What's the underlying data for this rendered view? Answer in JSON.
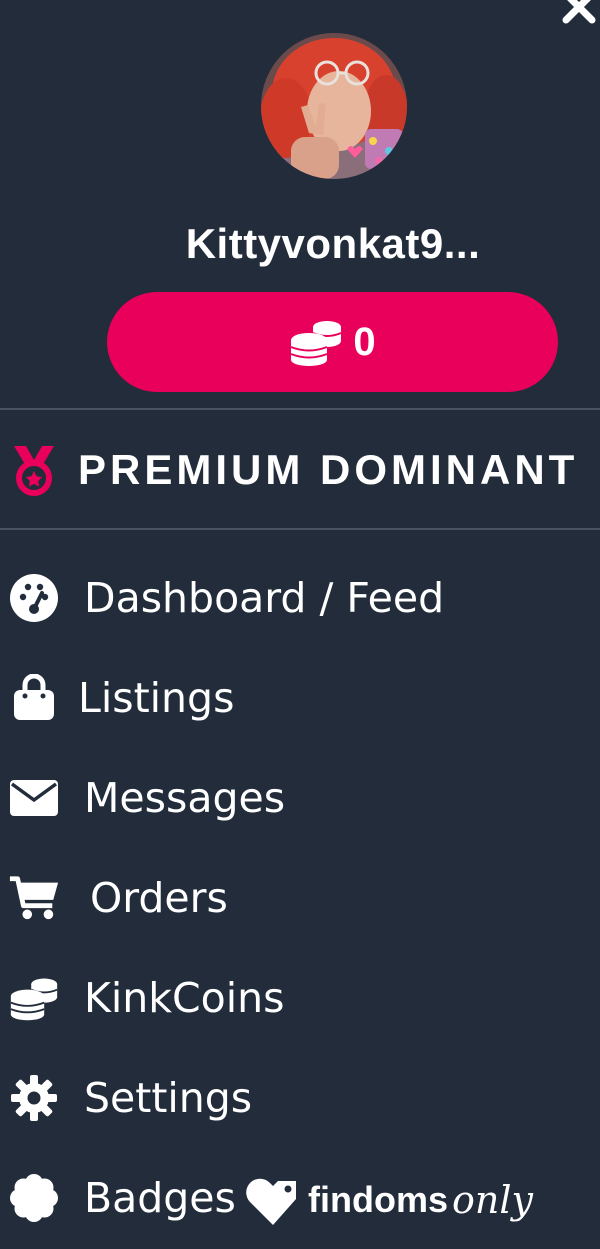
{
  "profile": {
    "username": "Kittyvonkat9...",
    "kinkcoin_balance": "0"
  },
  "plan": {
    "label": "PREMIUM DOMINANT"
  },
  "nav": {
    "items": [
      {
        "label": "Dashboard / Feed",
        "icon": "dashboard-gauge-icon"
      },
      {
        "label": "Listings",
        "icon": "shopping-bag-icon"
      },
      {
        "label": "Messages",
        "icon": "envelope-icon"
      },
      {
        "label": "Orders",
        "icon": "shopping-cart-icon"
      },
      {
        "label": "KinkCoins",
        "icon": "coins-icon"
      },
      {
        "label": "Settings",
        "icon": "gear-icon"
      },
      {
        "label": "Badges",
        "icon": "badge-icon"
      }
    ]
  },
  "brand": {
    "name_bold": "findoms",
    "name_script": "only",
    "logo_icon": "heart-tag-logo-icon"
  },
  "colors": {
    "background": "#222c3a",
    "accent": "#e8005a",
    "divider": "#485260",
    "text": "#ffffff"
  }
}
